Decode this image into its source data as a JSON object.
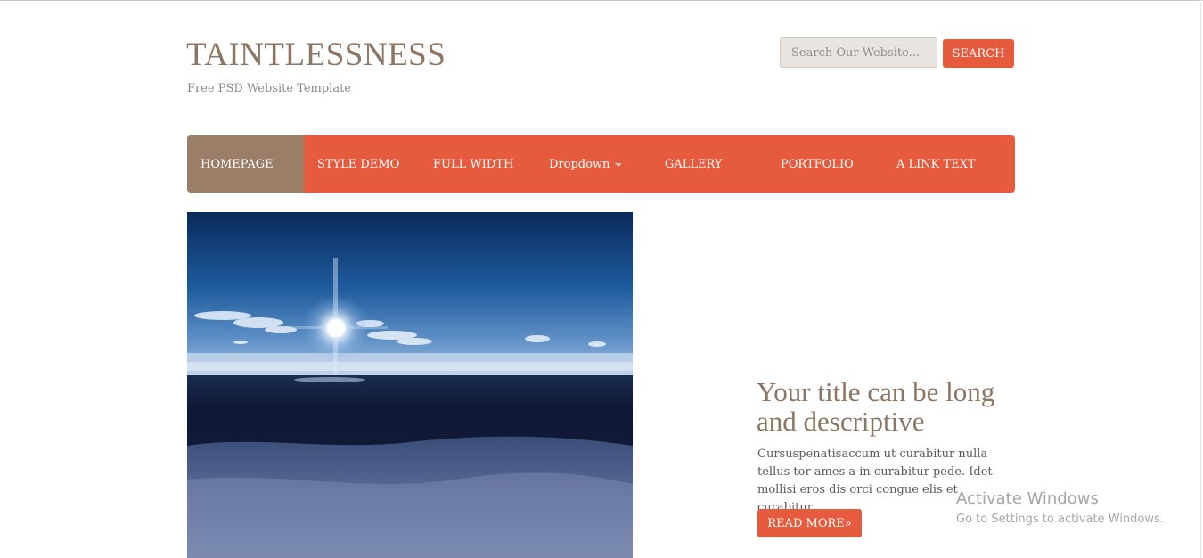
{
  "header": {
    "site_title": "TAINTLESSNESS",
    "tagline": "Free PSD Website Template"
  },
  "search": {
    "placeholder": "Search Our Website...",
    "value": "",
    "button_label": "SEARCH"
  },
  "nav": {
    "items": [
      {
        "label": "HOMEPAGE",
        "active": true
      },
      {
        "label": "STYLE DEMO"
      },
      {
        "label": "FULL WIDTH"
      },
      {
        "label": "Dropdown",
        "has_dropdown": true,
        "dropdown_icon": "caret-down-icon"
      },
      {
        "label": "GALLERY"
      },
      {
        "label": "PORTFOLIO"
      },
      {
        "label": "A LINK TEXT"
      }
    ]
  },
  "featured": {
    "image_alt": "winter-sunset-over-frozen-lake",
    "title": "Your title can be long and descriptive",
    "excerpt": "Cursuspenatisaccum ut curabitur nulla tellus tor ames a in curabitur pede. Idet mollisi eros dis orci congue elis et curabitur.",
    "read_more_label": "READ MORE»"
  },
  "watermark": {
    "title": "Activate Windows",
    "subtitle": "Go to Settings to activate Windows."
  },
  "colors": {
    "accent": "#e65b3d",
    "brand_brown": "#8c7562",
    "nav_active": "#9a7e68",
    "search_bg": "#e9e4df"
  }
}
